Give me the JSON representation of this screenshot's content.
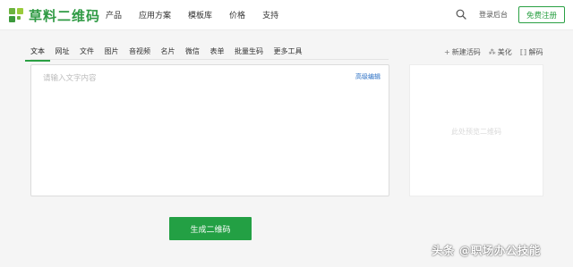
{
  "header": {
    "logo_text": "草料二维码",
    "nav": [
      "产品",
      "应用方案",
      "模板库",
      "价格",
      "支持"
    ],
    "login_label": "登录后台",
    "register_label": "免费注册"
  },
  "tabs": [
    {
      "label": "文本",
      "active": true
    },
    {
      "label": "网址",
      "active": false
    },
    {
      "label": "文件",
      "active": false
    },
    {
      "label": "图片",
      "active": false
    },
    {
      "label": "音视频",
      "active": false
    },
    {
      "label": "名片",
      "active": false
    },
    {
      "label": "微信",
      "active": false
    },
    {
      "label": "表单",
      "active": false
    },
    {
      "label": "批量生码",
      "active": false
    },
    {
      "label": "更多工具",
      "active": false
    }
  ],
  "tools": [
    {
      "icon": "plus-icon",
      "label": "新建活码"
    },
    {
      "icon": "beautify-icon",
      "label": "美化"
    },
    {
      "icon": "decode-icon",
      "label": "解码"
    }
  ],
  "editor": {
    "placeholder": "请输入文字内容",
    "value": "",
    "advanced_label": "高级编辑"
  },
  "preview": {
    "placeholder_text": "此处预览二维码"
  },
  "generate_label": "生成二维码",
  "watermark": "头条 @职场办公技能",
  "colors": {
    "brand_green": "#23a044",
    "link_blue": "#2a6fc4"
  }
}
